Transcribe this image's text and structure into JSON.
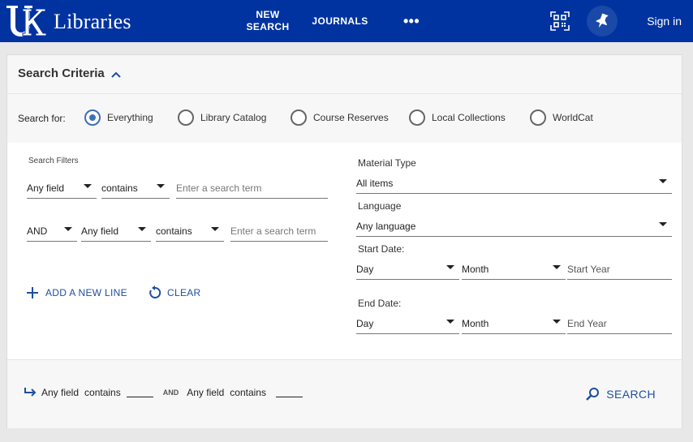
{
  "header": {
    "library_name": "Libraries",
    "logo_letters": "UK",
    "nav": {
      "new_search_line1": "NEW",
      "new_search_line2": "SEARCH",
      "journals": "JOURNALS",
      "more": "•••"
    },
    "sign_in": "Sign in"
  },
  "criteria": {
    "title": "Search Criteria",
    "search_for_label": "Search for:",
    "scopes": [
      {
        "label": "Everything",
        "checked": true
      },
      {
        "label": "Library Catalog",
        "checked": false
      },
      {
        "label": "Course Reserves",
        "checked": false
      },
      {
        "label": "Local Collections",
        "checked": false
      },
      {
        "label": "WorldCat",
        "checked": false
      }
    ]
  },
  "filters": {
    "title": "Search Filters",
    "line1": {
      "field": "Any field",
      "operator": "contains",
      "term_placeholder": "Enter a search term"
    },
    "line2": {
      "boolean": "AND",
      "field": "Any field",
      "operator": "contains",
      "term_placeholder": "Enter a search term"
    },
    "add_line": "ADD A NEW LINE",
    "clear": "CLEAR"
  },
  "advanced": {
    "material_type_label": "Material Type",
    "material_type_value": "All items",
    "language_label": "Language",
    "language_value": "Any language",
    "start_date_label": "Start Date:",
    "end_date_label": "End Date:",
    "day": "Day",
    "month": "Month",
    "start_year_placeholder": "Start Year",
    "end_year_placeholder": "End Year"
  },
  "summary": {
    "field1": "Any field",
    "op1": "contains",
    "boolean": "AND",
    "field2": "Any field",
    "op2": "contains",
    "search_button": "SEARCH"
  },
  "colors": {
    "brand_blue": "#0033a0",
    "accent_blue": "#1f4f9c"
  }
}
